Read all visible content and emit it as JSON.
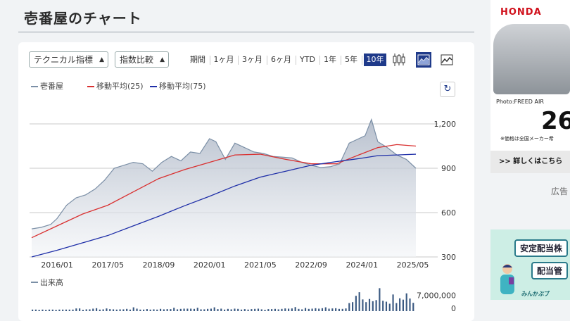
{
  "page": {
    "title": "壱番屋のチャート"
  },
  "controls": {
    "indicator_select": "テクニカル指標",
    "compare_select": "指数比較",
    "period_label": "期間",
    "periods": [
      "1ヶ月",
      "3ヶ月",
      "6ヶ月",
      "YTD",
      "1年",
      "5年",
      "10年"
    ],
    "selected_period": "10年",
    "chart_types": [
      "candlestick-icon",
      "area-chart-icon",
      "line-chart-icon"
    ],
    "selected_chart_type": "area-chart-icon",
    "refresh_icon": "refresh-icon"
  },
  "legend": {
    "price": "壱番屋",
    "ma25": "移動平均(25)",
    "ma75": "移動平均(75)",
    "volume": "出来高"
  },
  "colors": {
    "price_line": "#7b8fa6",
    "ma25": "#d93030",
    "ma75": "#1f2fa8",
    "volume_bar": "#3b5a82",
    "selected_bg": "#1f3a8a",
    "honda_red": "#d0101b"
  },
  "chart_data": [
    {
      "type": "area",
      "x_tick_labels": [
        "2016/01",
        "2017/05",
        "2018/09",
        "2020/01",
        "2021/05",
        "2022/09",
        "2024/01",
        "2025/05"
      ],
      "ylim": [
        300,
        1300
      ],
      "y_tick_labels": [
        "1,200",
        "900",
        "600",
        "300"
      ],
      "grid": true,
      "legend_position": "top-left",
      "series": [
        {
          "name": "壱番屋",
          "x": [
            "2015/05",
            "2015/08",
            "2015/11",
            "2016/01",
            "2016/04",
            "2016/07",
            "2016/10",
            "2017/01",
            "2017/04",
            "2017/07",
            "2017/10",
            "2018/01",
            "2018/04",
            "2018/07",
            "2018/10",
            "2019/01",
            "2019/04",
            "2019/07",
            "2019/10",
            "2020/01",
            "2020/03",
            "2020/06",
            "2020/09",
            "2020/12",
            "2021/03",
            "2021/06",
            "2021/09",
            "2021/12",
            "2022/03",
            "2022/06",
            "2022/09",
            "2022/12",
            "2023/03",
            "2023/06",
            "2023/09",
            "2023/12",
            "2024/02",
            "2024/04",
            "2024/06",
            "2024/09",
            "2024/12",
            "2025/03",
            "2025/06"
          ],
          "values": [
            490,
            500,
            520,
            560,
            650,
            700,
            720,
            760,
            820,
            900,
            920,
            940,
            930,
            880,
            940,
            980,
            950,
            1010,
            1000,
            1100,
            1080,
            960,
            1070,
            1040,
            1010,
            1000,
            980,
            975,
            970,
            940,
            920,
            905,
            910,
            930,
            1070,
            1100,
            1120,
            1230,
            1080,
            1040,
            990,
            960,
            900
          ]
        },
        {
          "name": "移動平均(25)",
          "x": [
            "2015/05",
            "2016/01",
            "2016/09",
            "2017/05",
            "2018/01",
            "2018/09",
            "2019/05",
            "2020/01",
            "2020/09",
            "2021/05",
            "2022/01",
            "2022/09",
            "2023/05",
            "2023/12",
            "2024/06",
            "2024/12",
            "2025/06"
          ],
          "values": [
            430,
            510,
            590,
            650,
            740,
            830,
            890,
            940,
            990,
            995,
            960,
            930,
            930,
            990,
            1040,
            1060,
            1050
          ]
        },
        {
          "name": "移動平均(75)",
          "x": [
            "2015/05",
            "2016/01",
            "2016/09",
            "2017/05",
            "2018/01",
            "2018/09",
            "2019/05",
            "2020/01",
            "2020/09",
            "2021/05",
            "2022/01",
            "2022/09",
            "2023/05",
            "2023/12",
            "2024/06",
            "2024/12",
            "2025/06"
          ],
          "values": [
            300,
            345,
            395,
            445,
            510,
            575,
            645,
            710,
            780,
            840,
            880,
            920,
            945,
            965,
            985,
            990,
            995
          ]
        }
      ]
    },
    {
      "type": "bar",
      "title": "出来高",
      "ylim": [
        0,
        10000000
      ],
      "y_tick_labels": [
        "7,000,000",
        "0"
      ],
      "values": [
        700000,
        700000,
        600000,
        700000,
        600000,
        700000,
        700000,
        600000,
        700000,
        700000,
        700000,
        700000,
        700000,
        1200000,
        1200000,
        600000,
        800000,
        800000,
        1100000,
        1300000,
        700000,
        800000,
        1200000,
        900000,
        800000,
        700000,
        800000,
        800000,
        1000000,
        700000,
        1700000,
        1100000,
        700000,
        700000,
        900000,
        700000,
        800000,
        700000,
        1000000,
        800000,
        900000,
        900000,
        1500000,
        800000,
        1000000,
        1100000,
        1100000,
        1100000,
        1000000,
        1500000,
        800000,
        800000,
        1000000,
        1100000,
        1700000,
        900000,
        1100000,
        700000,
        1000000,
        800000,
        1100000,
        1000000,
        700000,
        900000,
        700000,
        900000,
        1000000,
        1100000,
        800000,
        600000,
        900000,
        900000,
        1000000,
        800000,
        1000000,
        1200000,
        1100000,
        1200000,
        1800000,
        1000000,
        800000,
        1400000,
        1000000,
        1100000,
        1300000,
        1100000,
        1300000,
        1700000,
        1100000,
        1200000,
        1300000,
        1000000,
        1000000,
        1200000,
        3600000,
        4000000,
        6800000,
        8400000,
        5200000,
        4000000,
        5400000,
        4400000,
        4900000,
        10200000,
        4600000,
        4200000,
        3300000,
        7400000,
        3600000,
        5700000,
        5100000,
        7900000,
        5600000,
        3700000
      ]
    }
  ],
  "ads": {
    "honda": {
      "brand": "HONDA",
      "photo_caption": "Photo:FREED AIR",
      "price_partial": "26",
      "note": "※価格は全国メーカー希",
      "cta": ">> 詳しくはこちら"
    },
    "label": "広告",
    "second": {
      "bubble1": "安定配当株",
      "bubble2": "配当管",
      "footer": "みんかぶプ"
    }
  }
}
